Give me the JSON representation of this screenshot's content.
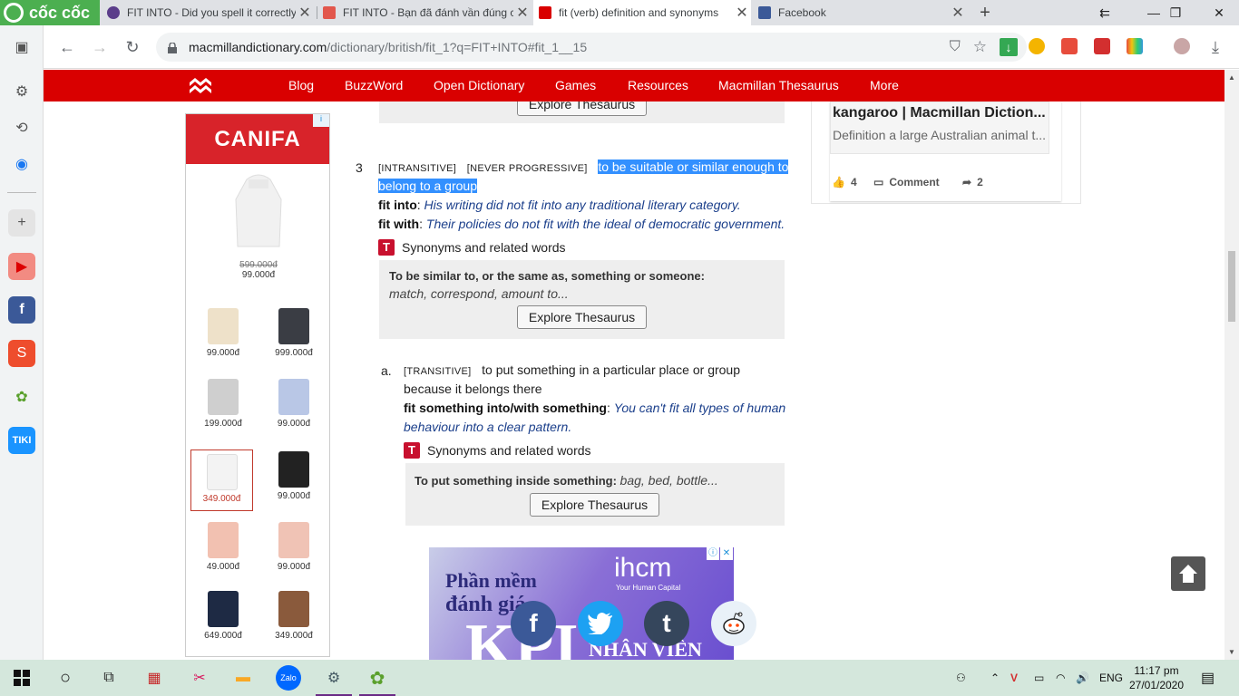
{
  "browser": {
    "brand": "cốc cốc",
    "tabs": [
      {
        "title": "FIT INTO - Did you spell it correctly",
        "active": false
      },
      {
        "title": "FIT INTO - Bạn đã đánh vần đúng c",
        "active": false
      },
      {
        "title": "fit (verb) definition and synonyms",
        "active": true
      },
      {
        "title": "Facebook",
        "active": false
      }
    ],
    "url_host": "macmillandictionary.com",
    "url_path": "/dictionary/british/fit_1?q=FIT+INTO#fit_1__15"
  },
  "site_nav": {
    "links": [
      "Blog",
      "BuzzWord",
      "Open Dictionary",
      "Games",
      "Resources",
      "Macmillan Thesaurus",
      "More"
    ]
  },
  "ad_canifa": {
    "brand": "CANIFA",
    "adchoice": "i",
    "top_old_price": "599.000đ",
    "top_new_price": "99.000đ",
    "products": [
      {
        "price": "99.000đ"
      },
      {
        "price": "999.000đ"
      },
      {
        "price": "199.000đ"
      },
      {
        "price": "99.000đ"
      },
      {
        "price": "349.000đ"
      },
      {
        "price": "99.000đ"
      },
      {
        "price": "49.000đ"
      },
      {
        "price": "99.000đ"
      },
      {
        "price": "649.000đ"
      },
      {
        "price": "349.000đ"
      }
    ]
  },
  "entry": {
    "top_button": "Explore Thesaurus",
    "sense3": {
      "number": "3",
      "gram1": "[INTRANSITIVE]",
      "gram2": "[NEVER PROGRESSIVE]",
      "def_line1": "to be suitable or similar enough to",
      "def_line2": "belong to a group",
      "ex1_pattern": "fit into",
      "ex1_text": "His writing did not fit into any traditional literary category.",
      "ex2_pattern": "fit with",
      "ex2_text": "Their policies do not fit with the ideal of democratic government.",
      "syn_heading": "Synonyms and related words",
      "syn_lead": "To be similar to, or the same as, something or someone:",
      "syn_list": "match, correspond, amount to...",
      "button": "Explore Thesaurus"
    },
    "sense3a": {
      "letter": "a.",
      "gram": "[TRANSITIVE]",
      "def_line1": "to put something in a particular place or group",
      "def_line2": "because it belongs there",
      "ex_pattern": "fit something into/with something",
      "ex_text_1": "You can't fit all types of human",
      "ex_text_2": "behaviour into a clear pattern.",
      "syn_heading": "Synonyms and related words",
      "syn_lead": "To put something inside something:",
      "syn_list": "bag, bed, bottle...",
      "button": "Explore Thesaurus"
    }
  },
  "related_card": {
    "title": "kangaroo | Macmillan Diction...",
    "desc": "Definition a large Australian animal t...",
    "likes": "4",
    "comment_label": "Comment",
    "shares": "2"
  },
  "ad_ihcm": {
    "line1": "Phần mềm",
    "line2": "đánh giá",
    "big": "KPI",
    "logo": "ihcm",
    "tagline": "Your Human Capital",
    "line3": "NHÂN VIÊN"
  },
  "share_buttons": [
    "f",
    "t",
    "t",
    "r"
  ],
  "taskbar": {
    "lang": "ENG",
    "time": "11:17 pm",
    "date": "27/01/2020"
  }
}
